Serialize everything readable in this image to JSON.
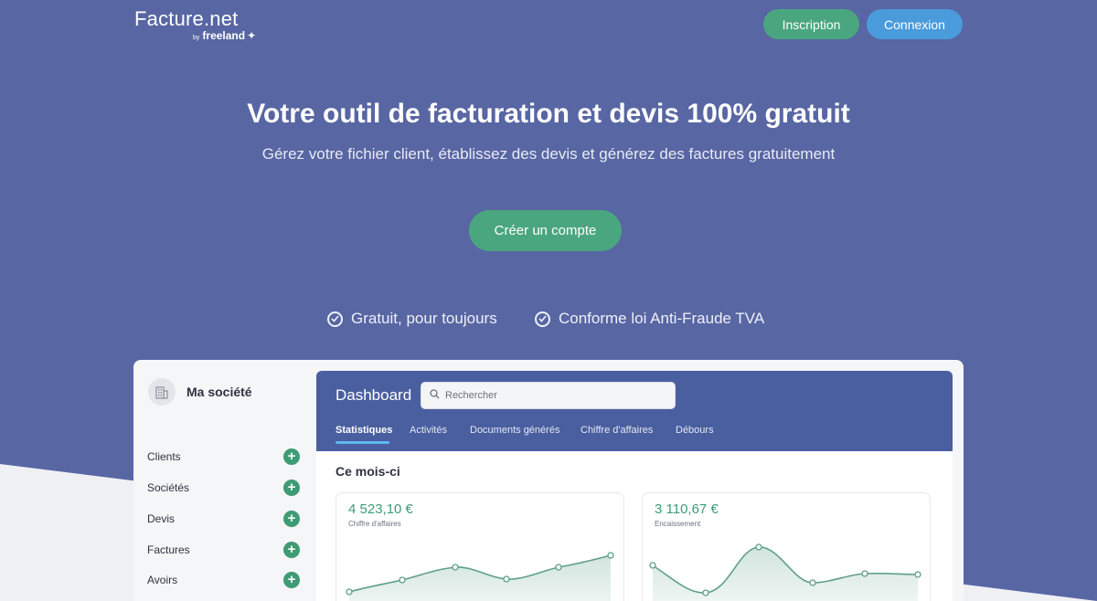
{
  "header": {
    "logo_main": "Facture.net",
    "logo_by": "by",
    "logo_brand": "freeland",
    "signup_label": "Inscription",
    "login_label": "Connexion"
  },
  "hero": {
    "title": "Votre outil de facturation et devis 100% gratuit",
    "subtitle": "Gérez votre fichier client, établissez des devis et générez des factures gratuitement",
    "cta_label": "Créer un compte",
    "features": [
      "Gratuit, pour toujours",
      "Conforme loi Anti-Fraude TVA"
    ]
  },
  "app": {
    "company_name": "Ma société",
    "sidebar_items": [
      "Clients",
      "Sociétés",
      "Devis",
      "Factures",
      "Avoirs"
    ],
    "dashboard_title": "Dashboard",
    "search_placeholder": "Rechercher",
    "tabs": [
      "Statistiques",
      "Activités",
      "Documents générés",
      "Chiffre d'affaires",
      "Débours"
    ],
    "active_tab": "Statistiques",
    "section_title": "Ce mois-ci",
    "cards": [
      {
        "value": "4 523,10 €",
        "label": "Chiffre d'affaires"
      },
      {
        "value": "3 110,67 €",
        "label": "Encaissement"
      }
    ]
  },
  "colors": {
    "background": "#5866a3",
    "accent_green": "#4aa67f",
    "accent_blue": "#4a9bdc",
    "dashboard_header": "#4a5fa0"
  },
  "icons": {
    "feature_check": "check-circle-icon",
    "company": "building-icon",
    "search": "search-icon",
    "add": "plus-icon",
    "logo_mark": "butterfly-icon"
  }
}
